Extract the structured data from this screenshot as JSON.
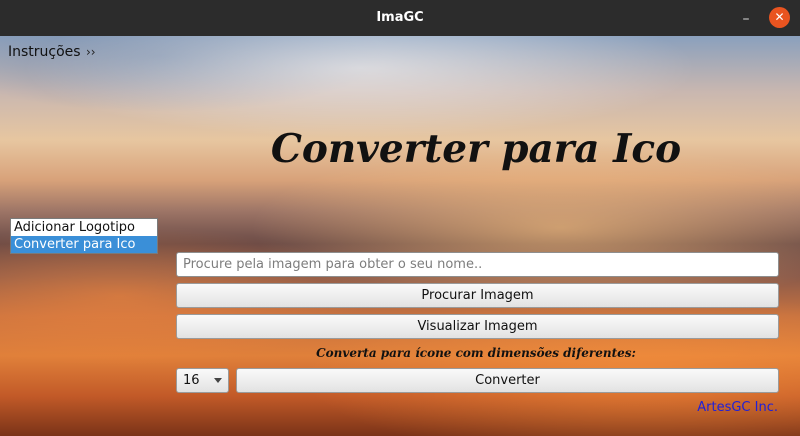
{
  "window": {
    "title": "ImaGC",
    "minimize_glyph": "–",
    "close_glyph": "✕"
  },
  "menubar": {
    "instrucoes_label": "Instruções",
    "more_glyph": "››"
  },
  "sidebar": {
    "items": [
      {
        "label": "Adicionar Logotipo",
        "selected": false
      },
      {
        "label": "Converter para Ico",
        "selected": true
      }
    ]
  },
  "main": {
    "heading": "Converter para Ico",
    "search": {
      "placeholder": "Procure pela imagem para obter o seu nome..",
      "value": ""
    },
    "browse_button": "Procurar Imagem",
    "preview_button": "Visualizar Imagem",
    "subtitle": "Converta para ícone com dimensões diferentes:",
    "size_select": {
      "value": "16"
    },
    "convert_button": "Converter"
  },
  "footer": {
    "credit": "ArtesGC Inc."
  },
  "colors": {
    "titlebar": "#2c2c2c",
    "close_button": "#e95420",
    "selection": "#3a8fd8",
    "credit": "#2020d8"
  },
  "icons": [
    "minimize-icon",
    "close-icon",
    "chevron-right-icon",
    "dropdown-arrow-icon"
  ]
}
